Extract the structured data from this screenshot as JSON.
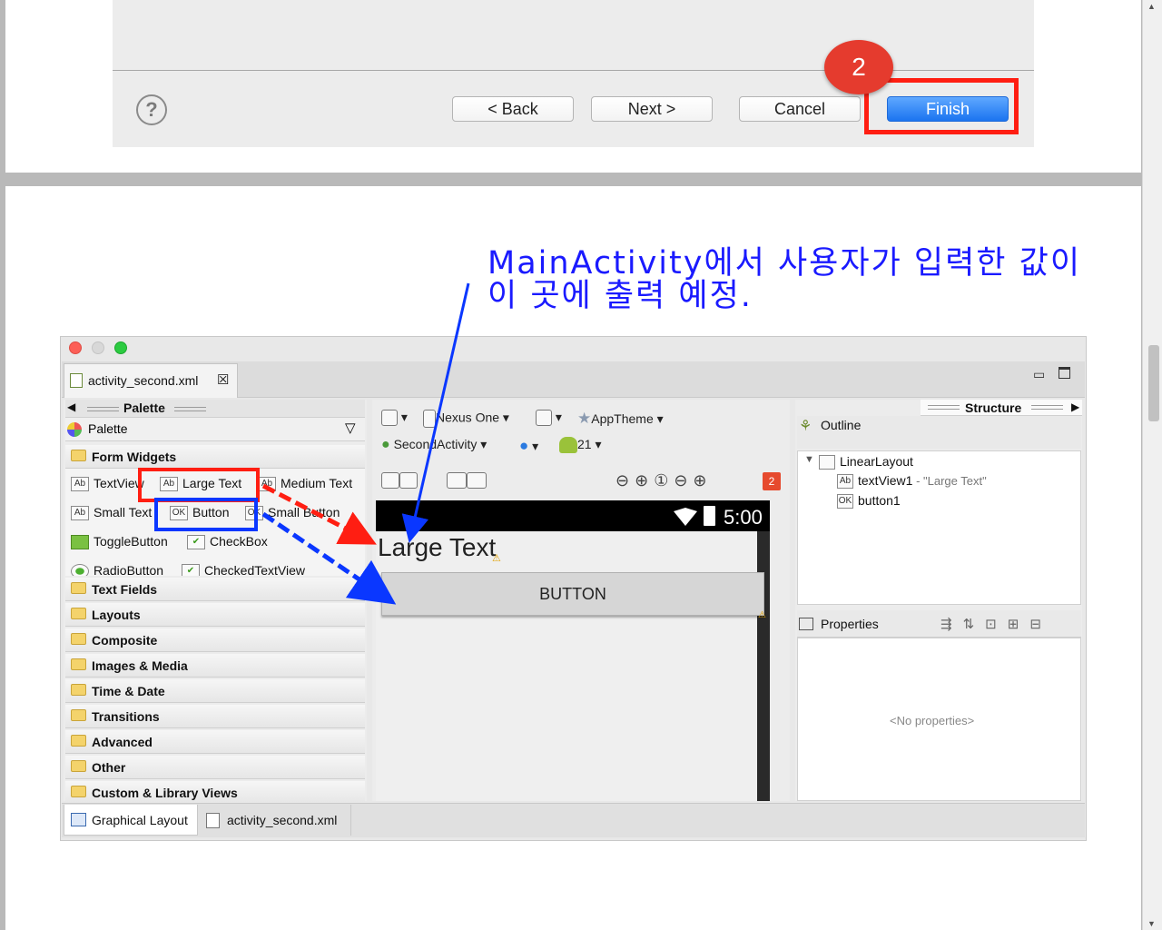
{
  "wizard": {
    "help_glyph": "?",
    "back_label": "< Back",
    "next_label": "Next >",
    "cancel_label": "Cancel",
    "finish_label": "Finish",
    "step_number": "2"
  },
  "annotation": {
    "text": "MainActivity에서 사용자가 입력한 값이\n이 곳에 출력 예정."
  },
  "editor": {
    "file_tab": "activity_second.xml",
    "palette_title": "Palette",
    "palette_dropdown": "Palette",
    "form_widgets": "Form Widgets",
    "widgets": [
      {
        "icon": "Ab",
        "label": "TextView"
      },
      {
        "icon": "Ab",
        "label": "Large Text"
      },
      {
        "icon": "Ab",
        "label": "Medium Text"
      },
      {
        "icon": "Ab",
        "label": "Small Text"
      },
      {
        "icon": "OK",
        "label": "Button"
      },
      {
        "icon": "OK",
        "label": "Small Button"
      },
      {
        "icon": "",
        "label": "ToggleButton"
      },
      {
        "icon": "✔",
        "label": "CheckBox"
      },
      {
        "icon": "",
        "label": "RadioButton"
      },
      {
        "icon": "✔",
        "label": "CheckedTextView"
      }
    ],
    "folders": [
      "Text Fields",
      "Layouts",
      "Composite",
      "Images & Media",
      "Time & Date",
      "Transitions",
      "Advanced",
      "Other",
      "Custom & Library Views"
    ],
    "toolbar": {
      "device": "Nexus One",
      "theme": "AppTheme",
      "activity": "SecondActivity",
      "api": "21",
      "error_count": "2"
    },
    "device_screen": {
      "clock": "5:00",
      "large_text": "Large Text",
      "button_label": "BUTTON"
    },
    "structure_title": "Structure",
    "outline_title": "Outline",
    "outline_items": [
      {
        "icon": "",
        "label": "LinearLayout",
        "detail": ""
      },
      {
        "icon": "Ab",
        "label": "textView1",
        "detail": " - \"Large Text\""
      },
      {
        "icon": "OK",
        "label": "button1",
        "detail": ""
      }
    ],
    "properties_title": "Properties",
    "no_properties": "<No properties>",
    "bottom_tabs": [
      "Graphical Layout",
      "activity_second.xml"
    ]
  },
  "colors": {
    "finish_blue": "#1b74f0",
    "highlight_red": "#ff1e12",
    "highlight_blue": "#0a37ff",
    "annotation_blue": "#1a1aff"
  }
}
